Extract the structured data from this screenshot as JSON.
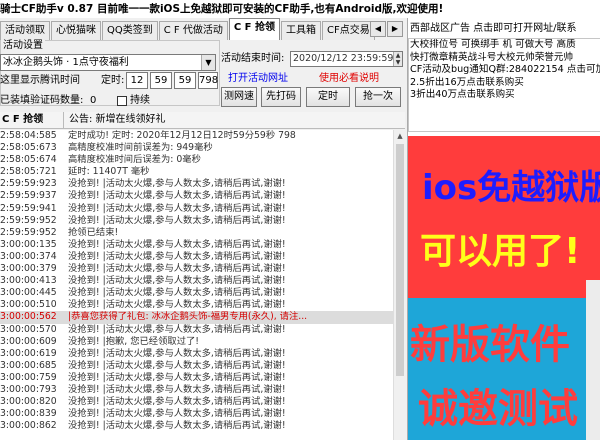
{
  "window": {
    "title": "骑士CF助手v 0.87 目前唯一一款iOS上免越狱即可安装的CF助手,也有Android版,欢迎使用!"
  },
  "tabs": [
    {
      "label": "活动领取"
    },
    {
      "label": "心悦猫咪"
    },
    {
      "label": "QQ类签到"
    },
    {
      "label": "C F 代做活动"
    },
    {
      "label": "C F 抢领"
    },
    {
      "label": "工具箱"
    },
    {
      "label": "CF点交易"
    }
  ],
  "tab_arrows": {
    "left": "◀",
    "right": "▶"
  },
  "settings": {
    "group_title": "活动设置",
    "selected_item": "冰冰企鹅头饰 · 1点守夜福利",
    "dropdown_glyph": "▼",
    "time_label": "这里显示腾讯时间",
    "fixed_label": "定时:",
    "hour": "12",
    "minute": "59",
    "second": "59",
    "ms": "798",
    "verify_label": "已装填验证码数量:",
    "verify_count": "0",
    "continue_label": "持续"
  },
  "activity": {
    "end_label": "活动结束时间:",
    "end_time": "2020/12/12  23:59:59",
    "open_url": "打开活动网址",
    "must_read": "使用必看说明"
  },
  "buttons": {
    "test": "测网速",
    "code": "先打码",
    "timer": "定时",
    "grab": "抢一次"
  },
  "log": {
    "header_left": "C F 抢领",
    "header_right": "公告: 新增在线领好礼",
    "rows": [
      {
        "time": "2:58:04:585",
        "msg": "定时成功! 定时: 2020年12月12日12时59分59秒 798",
        "red": false
      },
      {
        "time": "2:58:05:673",
        "msg": "高精度校准时间前误差为: 949毫秒",
        "red": false
      },
      {
        "time": "2:58:05:674",
        "msg": "高精度校准时间后误差为: 0毫秒",
        "red": false
      },
      {
        "time": "2:58:05:721",
        "msg": "延时: 11407T 毫秒",
        "red": false
      },
      {
        "time": "2:59:59:923",
        "msg": "没抢到! |活动太火爆,参与人数太多,请稍后再试,谢谢!",
        "red": false
      },
      {
        "time": "2:59:59:937",
        "msg": "没抢到! |活动太火爆,参与人数太多,请稍后再试,谢谢!",
        "red": false
      },
      {
        "time": "2:59:59:941",
        "msg": "没抢到! |活动太火爆,参与人数太多,请稍后再试,谢谢!",
        "red": false
      },
      {
        "time": "2:59:59:952",
        "msg": "没抢到! |活动太火爆,参与人数太多,请稍后再试,谢谢!",
        "red": false
      },
      {
        "time": "2:59:59:952",
        "msg": "抢领已结束!",
        "red": false
      },
      {
        "time": "3:00:00:135",
        "msg": "没抢到! |活动太火爆,参与人数太多,请稍后再试,谢谢!",
        "red": false
      },
      {
        "time": "3:00:00:374",
        "msg": "没抢到! |活动太火爆,参与人数太多,请稍后再试,谢谢!",
        "red": false
      },
      {
        "time": "3:00:00:379",
        "msg": "没抢到! |活动太火爆,参与人数太多,请稍后再试,谢谢!",
        "red": false
      },
      {
        "time": "3:00:00:413",
        "msg": "没抢到! |活动太火爆,参与人数太多,请稍后再试,谢谢!",
        "red": false
      },
      {
        "time": "3:00:00:445",
        "msg": "没抢到! |活动太火爆,参与人数太多,请稍后再试,谢谢!",
        "red": false
      },
      {
        "time": "3:00:00:510",
        "msg": "没抢到! |活动太火爆,参与人数太多,请稍后再试,谢谢!",
        "red": false
      },
      {
        "time": "3:00:00:562",
        "msg": "|恭喜您获得了礼包: 冰冰企鹅头饰-福男专用(永久), 请注...",
        "red": true
      },
      {
        "time": "3:00:00:570",
        "msg": "没抢到! |活动太火爆,参与人数太多,请稍后再试,谢谢!",
        "red": false
      },
      {
        "time": "3:00:00:609",
        "msg": "没抢到! |抱歉, 您已经领取过了!",
        "red": false
      },
      {
        "time": "3:00:00:619",
        "msg": "没抢到! |活动太火爆,参与人数太多,请稍后再试,谢谢!",
        "red": false
      },
      {
        "time": "3:00:00:685",
        "msg": "没抢到! |活动太火爆,参与人数太多,请稍后再试,谢谢!",
        "red": false
      },
      {
        "time": "3:00:00:759",
        "msg": "没抢到! |活动太火爆,参与人数太多,请稍后再试,谢谢!",
        "red": false
      },
      {
        "time": "3:00:00:793",
        "msg": "没抢到! |活动太火爆,参与人数太多,请稍后再试,谢谢!",
        "red": false
      },
      {
        "time": "3:00:00:820",
        "msg": "没抢到! |活动太火爆,参与人数太多,请稍后再试,谢谢!",
        "red": false
      },
      {
        "time": "3:00:00:839",
        "msg": "没抢到! |活动太火爆,参与人数太多,请稍后再试,谢谢!",
        "red": false
      },
      {
        "time": "3:00:00:862",
        "msg": "没抢到! |活动太火爆,参与人数太多,请稍后再试,谢谢!",
        "red": false
      }
    ]
  },
  "ad": {
    "title": "西部战区广告 点击即可打开网址/联系",
    "lines": [
      "大校排位号 可换绑手 机 可做大号 高质",
      "快打微章精英战斗号大校元帅荣誉元帅",
      "CF活动及bug通知Q群:284022154 点击可加",
      "2.5折出16万点击联系购买",
      "3折出40万点击联系购买"
    ],
    "banner1_line1": "ios免越狱版",
    "banner1_line2": "可以用了!",
    "banner2_line1": "新版软件",
    "banner2_line2": "诚邀测试"
  },
  "colors": {
    "red_banner": "#ff3c3c",
    "blue_banner": "#1ea6d8",
    "link_blue": "#0000ee",
    "link_red": "#e00000"
  },
  "icons": {
    "dropdown": "chevron-down-icon",
    "scroll_up": "scroll-up-icon",
    "tab_prev": "chevron-left-icon",
    "tab_next": "chevron-right-icon"
  }
}
